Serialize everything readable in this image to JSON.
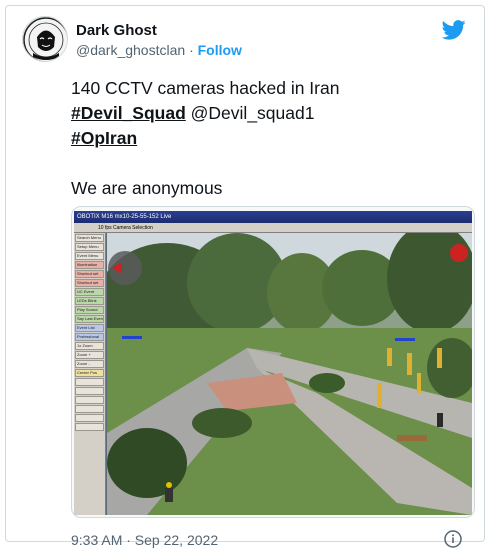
{
  "tweet": {
    "author_name": "Dark Ghost",
    "author_handle": "@dark_ghostclan",
    "separator": "·",
    "follow_label": "Follow",
    "text_line1": "140 CCTV cameras hacked in Iran",
    "hashtag1": "#Devil_Squad",
    "mention": "@Devil_squad1",
    "hashtag2": "#OpIran",
    "text_line4": "We are anonymous",
    "timestamp": "9:33 AM · Sep 22, 2022"
  },
  "media": {
    "cam_title": "OBOTIX M16  mx10-25-55-152  Live",
    "toolbar_text": "10 fps   Camera Selection",
    "sidebar_buttons": [
      {
        "label": "Search Menu",
        "tone": "n"
      },
      {
        "label": "Setup Menu",
        "tone": "n"
      },
      {
        "label": "Event Menu",
        "tone": "n"
      },
      {
        "label": "Illumination",
        "tone": "r"
      },
      {
        "label": "Shortcut set",
        "tone": "r"
      },
      {
        "label": "Shortcut set",
        "tone": "r"
      },
      {
        "label": "UC Event",
        "tone": "g"
      },
      {
        "label": "LEDs Blink",
        "tone": "g"
      },
      {
        "label": "Play Sound",
        "tone": "g"
      },
      {
        "label": "Say Last Event",
        "tone": "g"
      },
      {
        "label": "Event List",
        "tone": "b"
      },
      {
        "label": "Professional",
        "tone": "b"
      },
      {
        "label": "1x Zoom",
        "tone": "n"
      },
      {
        "label": "Zoom +",
        "tone": "n"
      },
      {
        "label": "Zoom -",
        "tone": "n"
      },
      {
        "label": "Center Pos",
        "tone": "y"
      },
      {
        "label": "",
        "tone": "n"
      },
      {
        "label": "",
        "tone": "n"
      },
      {
        "label": "",
        "tone": "n"
      },
      {
        "label": "",
        "tone": "n"
      },
      {
        "label": "",
        "tone": "n"
      },
      {
        "label": "",
        "tone": "n"
      }
    ]
  },
  "colors": {
    "brand_blue": "#1d9bf0",
    "text_secondary": "#536471"
  }
}
